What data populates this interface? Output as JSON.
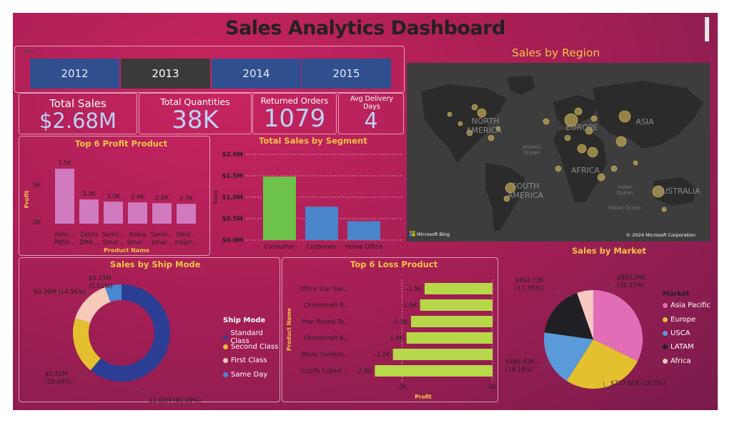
{
  "title": "Sales Analytics Dashboard",
  "year_slicer": {
    "label": "Year",
    "years": [
      "2012",
      "2013",
      "2014",
      "2015"
    ],
    "selected": "2013"
  },
  "kpis": {
    "total_sales": {
      "label": "Total Sales",
      "value": "$2.68M"
    },
    "total_quantities": {
      "label": "Total Quantities",
      "value": "38K"
    },
    "returned_orders": {
      "label": "Returned Orders",
      "value": "1079"
    },
    "avg_delivery": {
      "label": "Avg Delivery Days",
      "value": "4"
    }
  },
  "profit_chart": {
    "title": "Top 6 Profit Product",
    "ylabel": "Profit",
    "xlabel": "Product Name",
    "yticks": [
      "5K",
      "0K"
    ],
    "data_labels": [
      "7.5K",
      "3.3K",
      "3.0K",
      "2.9K",
      "2.8K",
      "2.7K"
    ],
    "cat_line1": [
      "Fello...",
      "Zebra",
      "Sams...",
      "Nokia",
      "Sams...",
      "Okid..."
    ],
    "cat_line2": [
      "PB50...",
      "ZM4...",
      "Smar...",
      "Smar...",
      "Smar...",
      "Inkjet..."
    ]
  },
  "segment_chart": {
    "title": "Total Sales by Segment",
    "ylabel": "Sales",
    "yticks": [
      "$2.0M",
      "$1.5M",
      "$1.0M",
      "$0.5M",
      "$0.0M"
    ],
    "categories": [
      "Consumer",
      "Corporate",
      "Home Office"
    ]
  },
  "region_map": {
    "title": "Sales by Region",
    "labels": {
      "north_america": "NORTH\nAMERICA",
      "europe": "EUROPE",
      "asia": "ASIA",
      "africa": "AFRICA",
      "south_america": "SOUTH\nAMERICA",
      "australia": "AUSTRALIA",
      "atlantic": "Atlantic\nOcean",
      "indian": "Indian\nOcean",
      "indian2": "Indian Ocean"
    },
    "bing": "Microsoft Bing",
    "copyright": "© 2024 Microsoft Corporation"
  },
  "ship_chart": {
    "title": "Sales by Ship Mode",
    "legend_title": "Ship Mode",
    "legend": [
      "Standard Class",
      "Second Class",
      "First Class",
      "Same Day"
    ],
    "labels": {
      "standard": "$1.63M (60.99%)",
      "second": "$0.51M\n(18.94%)",
      "first": "$0.39M (14.56%)",
      "same_day": "$0.15M\n(5.51%)"
    }
  },
  "loss_chart": {
    "title": "Top 6 Loss Product",
    "ylabel": "Product Name",
    "xlabel": "Profit",
    "products": [
      "Office Star Swi...",
      "Chromcraft R...",
      "Hon Round Ta...",
      "Chromcraft B...",
      "Bevis Confere...",
      "Cubify CubeX ..."
    ],
    "data_labels": [
      "-1.5K",
      "-1.6K",
      "-1.8K",
      "-1.9K",
      "-2.2K",
      "-2.6K"
    ],
    "xticks": [
      "-2K",
      "0K"
    ]
  },
  "market_chart": {
    "title": "Sales by Market",
    "legend_title": "Market",
    "legend": [
      "Asia Pacific",
      "Europe",
      "USCA",
      "LATAM",
      "Africa"
    ],
    "labels": {
      "asia": "$863.98K\n(32.27%)",
      "europe": "$717.61K (26.8%)",
      "usca": "$486.63K\n(18.18%)",
      "latam": "$464.73K\n(17.36%)"
    }
  },
  "chart_data": [
    {
      "type": "bar",
      "title": "Top 6 Profit Product",
      "xlabel": "Product Name",
      "ylabel": "Profit",
      "categories": [
        "Fello... PB50...",
        "Zebra ZM4...",
        "Sams... Smar...",
        "Nokia Smar...",
        "Sams... Smar...",
        "Okid... Inkjet..."
      ],
      "values": [
        7500,
        3300,
        3000,
        2900,
        2800,
        2700
      ],
      "ylim": [
        0,
        8000
      ],
      "color": "#d07ac0"
    },
    {
      "type": "bar",
      "title": "Total Sales by Segment",
      "xlabel": "",
      "ylabel": "Sales",
      "categories": [
        "Consumer",
        "Corporate",
        "Home Office"
      ],
      "values": [
        1.48,
        0.78,
        0.44
      ],
      "ylim": [
        0,
        2.0
      ],
      "colors": [
        "#6cc24a",
        "#4a84c9",
        "#4a84c9"
      ]
    },
    {
      "type": "pie",
      "title": "Sales by Ship Mode",
      "categories": [
        "Standard Class",
        "Second Class",
        "First Class",
        "Same Day"
      ],
      "values": [
        60.99,
        18.94,
        14.56,
        5.51
      ],
      "colors": [
        "#2c3e93",
        "#e3c030",
        "#f6c9b8",
        "#4a88d0"
      ]
    },
    {
      "type": "bar",
      "title": "Top 6 Loss Product",
      "xlabel": "Profit",
      "ylabel": "Product Name",
      "categories": [
        "Office Star Swi...",
        "Chromcraft R...",
        "Hon Round Ta...",
        "Chromcraft B...",
        "Bevis Confere...",
        "Cubify CubeX ..."
      ],
      "values": [
        -1500,
        -1600,
        -1800,
        -1900,
        -2200,
        -2600
      ],
      "xlim": [
        -3000,
        0
      ],
      "color": "#b6d84a"
    },
    {
      "type": "pie",
      "title": "Sales by Market",
      "categories": [
        "Asia Pacific",
        "Europe",
        "USCA",
        "LATAM",
        "Africa"
      ],
      "values": [
        32.27,
        26.8,
        18.18,
        17.36,
        5.39
      ],
      "colors": [
        "#e06db5",
        "#e3c030",
        "#5b9ad8",
        "#1f1f24",
        "#f7c9bf"
      ]
    }
  ]
}
